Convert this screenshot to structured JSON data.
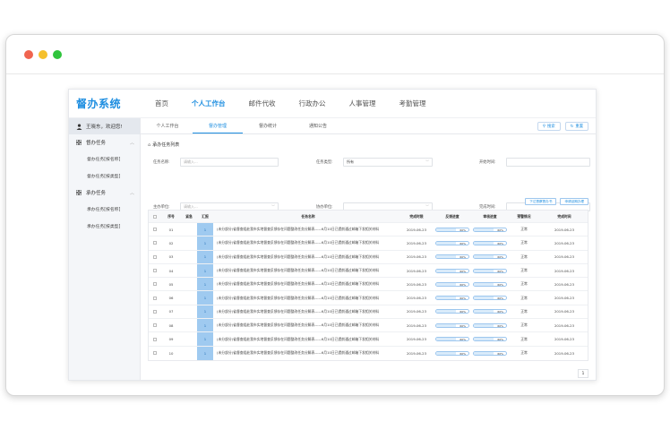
{
  "app": {
    "logo": "督办系统"
  },
  "nav": [
    {
      "label": "首页",
      "active": false
    },
    {
      "label": "个人工作台",
      "active": true
    },
    {
      "label": "邮件代收",
      "active": false
    },
    {
      "label": "行政办公",
      "active": false
    },
    {
      "label": "人事管理",
      "active": false
    },
    {
      "label": "考勤管理",
      "active": false
    }
  ],
  "sidebar": {
    "user_greeting": "王晓东，欢迎您!",
    "groups": [
      {
        "title": "督办任务",
        "chevron": "︿",
        "items": [
          "督办任务[按名称]",
          "督办任务[按类型]"
        ]
      },
      {
        "title": "承办任务",
        "chevron": "︿",
        "items": [
          "承办任务[按名称]",
          "承办任务[按类型]"
        ]
      }
    ]
  },
  "tabs": [
    {
      "label": "个人工作台",
      "active": false
    },
    {
      "label": "督办管理",
      "active": true
    },
    {
      "label": "督办统计",
      "active": false
    },
    {
      "label": "通知公告",
      "active": false
    }
  ],
  "toolbar": {
    "search_label": "搜索",
    "reset_label": "重置"
  },
  "section_title": "承办任务列表",
  "filters": {
    "task_name": {
      "label": "任务名称:",
      "placeholder": "请输入..."
    },
    "task_type": {
      "label": "任务类型:",
      "value": "所有"
    },
    "start_time": {
      "label": "开始时间:"
    },
    "lead_unit": {
      "label": "主办单位:",
      "placeholder": "请输入..."
    },
    "assist_unit": {
      "label": "协办单位:"
    },
    "end_time": {
      "label": "完成时间:"
    }
  },
  "actions": {
    "issue_label": "下达督察督办书",
    "apply_label": "申请延期办理"
  },
  "table": {
    "headers": [
      "序号",
      "紧急",
      "汇报",
      "任务名称",
      "完成时限",
      "反馈进度",
      "审核进度",
      "预警情况",
      "完成时间"
    ],
    "rows": [
      {
        "no": "01",
        "sup": "1",
        "name": "(未分部分)省督查组赴我市实地督查反馈存在问题整改任务分解表——6月10日已提前通过邮箱下发相关材料",
        "deadline": "2019-06-23",
        "fb": "60%",
        "audit": "60%",
        "status": "正常",
        "done": "2019-06-23"
      },
      {
        "no": "02",
        "sup": "1",
        "name": "(未分部分)省督查组赴我市实地督查反馈存在问题整改任务分解表——6月10日已提前通过邮箱下发相关材料",
        "deadline": "2019-06-23",
        "fb": "60%",
        "audit": "60%",
        "status": "正常",
        "done": "2019-06-23"
      },
      {
        "no": "03",
        "sup": "1",
        "name": "(未分部分)省督查组赴我市实地督查反馈存在问题整改任务分解表——6月10日已提前通过邮箱下发相关材料",
        "deadline": "2019-06-23",
        "fb": "60%",
        "audit": "60%",
        "status": "正常",
        "done": "2019-06-23"
      },
      {
        "no": "04",
        "sup": "1",
        "name": "(未分部分)省督查组赴我市实地督查反馈存在问题整改任务分解表——6月10日已提前通过邮箱下发相关材料",
        "deadline": "2019-06-23",
        "fb": "60%",
        "audit": "60%",
        "status": "正常",
        "done": "2019-06-23"
      },
      {
        "no": "05",
        "sup": "1",
        "name": "(未分部分)省督查组赴我市实地督查反馈存在问题整改任务分解表——6月10日已提前通过邮箱下发相关材料",
        "deadline": "2019-06-23",
        "fb": "60%",
        "audit": "60%",
        "status": "正常",
        "done": "2019-06-23"
      },
      {
        "no": "06",
        "sup": "1",
        "name": "(未分部分)省督查组赴我市实地督查反馈存在问题整改任务分解表——6月10日已提前通过邮箱下发相关材料",
        "deadline": "2019-06-23",
        "fb": "60%",
        "audit": "60%",
        "status": "正常",
        "done": "2019-06-23"
      },
      {
        "no": "07",
        "sup": "1",
        "name": "(未分部分)省督查组赴我市实地督查反馈存在问题整改任务分解表——6月10日已提前通过邮箱下发相关材料",
        "deadline": "2019-06-23",
        "fb": "60%",
        "audit": "60%",
        "status": "正常",
        "done": "2019-06-23"
      },
      {
        "no": "08",
        "sup": "1",
        "name": "(未分部分)省督查组赴我市实地督查反馈存在问题整改任务分解表——6月10日已提前通过邮箱下发相关材料",
        "deadline": "2019-06-23",
        "fb": "60%",
        "audit": "60%",
        "status": "正常",
        "done": "2019-06-23"
      },
      {
        "no": "09",
        "sup": "1",
        "name": "(未分部分)省督查组赴我市实地督查反馈存在问题整改任务分解表——6月10日已提前通过邮箱下发相关材料",
        "deadline": "2019-06-23",
        "fb": "60%",
        "audit": "60%",
        "status": "正常",
        "done": "2019-06-23"
      },
      {
        "no": "10",
        "sup": "1",
        "name": "(未分部分)省督查组赴我市实地督查反馈存在问题整改任务分解表——6月10日已提前通过邮箱下发相关材料",
        "deadline": "2019-06-23",
        "fb": "60%",
        "audit": "60%",
        "status": "正常",
        "done": "2019-06-23"
      }
    ]
  },
  "pagination": {
    "current": "1"
  },
  "colors": {
    "accent": "#1e8ee0",
    "sup_cell": "#9fcaf0",
    "sidebar_bg": "#f4f6f9"
  },
  "icons": {
    "user": "user-icon",
    "grid": "grid-icon",
    "search": "search-icon",
    "reset": "refresh-icon",
    "list": "list-icon"
  }
}
